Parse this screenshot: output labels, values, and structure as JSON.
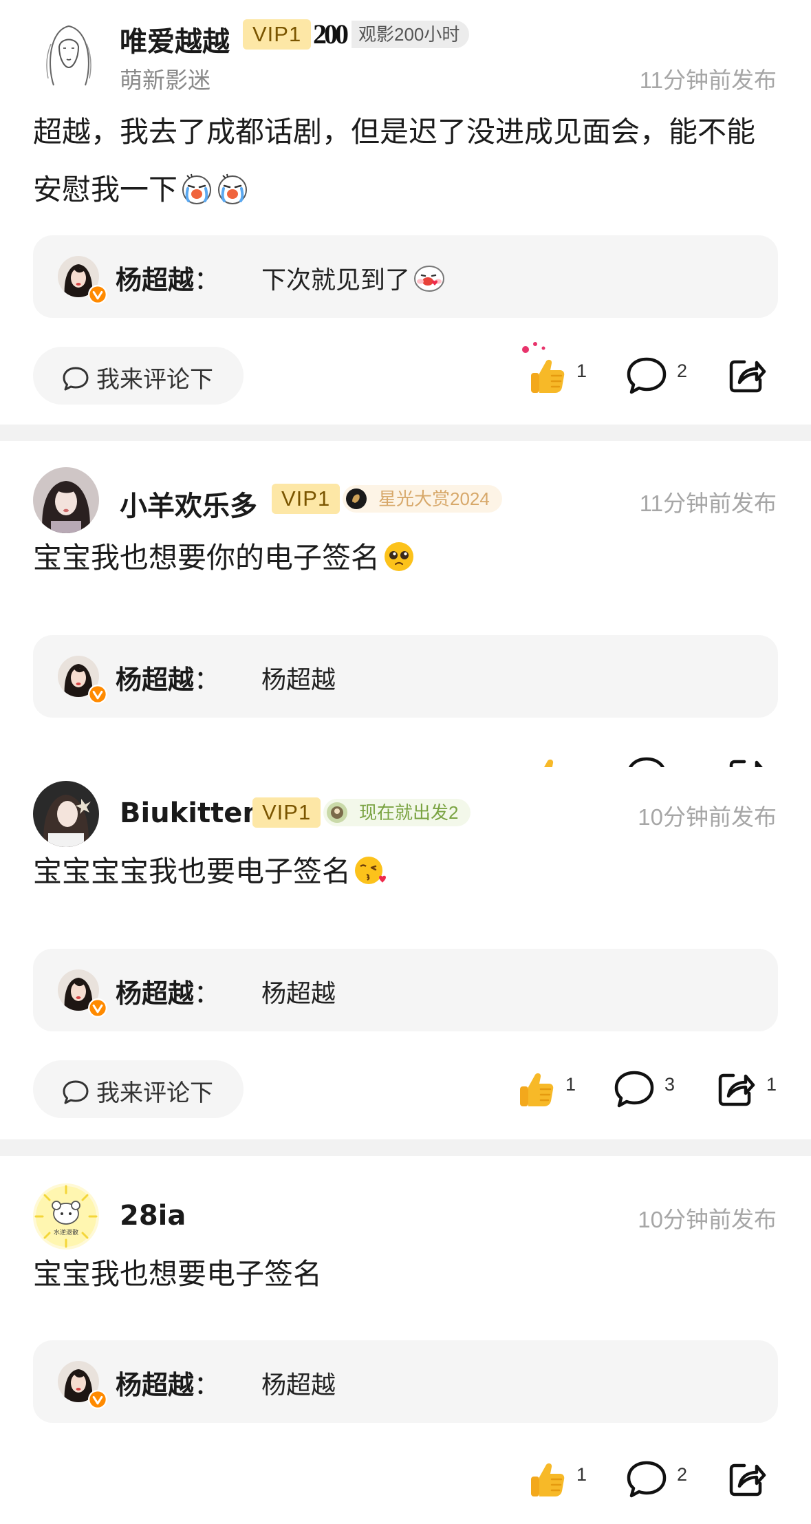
{
  "posts": [
    {
      "username": "唯爱越越",
      "vip": "VIP1",
      "badge_text": "观影200小时",
      "badge_prefix": "200",
      "subtitle": "萌新影迷",
      "time": "11分钟前发布",
      "content": "超越，我去了成都话剧，但是迟了没进成见面会，能不能安慰我一下",
      "reply_name": "杨超越",
      "reply_sep": "：",
      "reply_text": "下次就见到了",
      "comment_placeholder": "我来评论下",
      "likes": "1",
      "comments": "2"
    },
    {
      "username": "小羊欢乐多",
      "vip": "VIP1",
      "badge_text": "星光大赏2024",
      "time": "11分钟前发布",
      "content": "宝宝我也想要你的电子签名",
      "reply_name": "杨超越",
      "reply_sep": "：",
      "reply_text": "杨超越"
    },
    {
      "username": "Biukitten",
      "vip": "VIP1",
      "badge_text": "现在就出发2",
      "time": "10分钟前发布",
      "content": "宝宝宝宝我也要电子签名",
      "reply_name": "杨超越",
      "reply_sep": "：",
      "reply_text": "杨超越",
      "comment_placeholder": "我来评论下",
      "likes": "1",
      "comments": "3",
      "shares": "1"
    },
    {
      "username": "28ia",
      "avatar_text": "水逆退散",
      "time": "10分钟前发布",
      "content": "宝宝我也想要电子签名",
      "reply_name": "杨超越",
      "reply_sep": "：",
      "reply_text": "杨超越",
      "likes": "1",
      "comments": "2"
    }
  ],
  "icons": {
    "like": "thumbs-up-icon",
    "comment": "comment-bubble-icon",
    "share": "share-icon"
  },
  "colors": {
    "vip_bg": "#fde7a6",
    "reply_bg": "#f5f5f5",
    "like_yellow": "#f7b928"
  }
}
